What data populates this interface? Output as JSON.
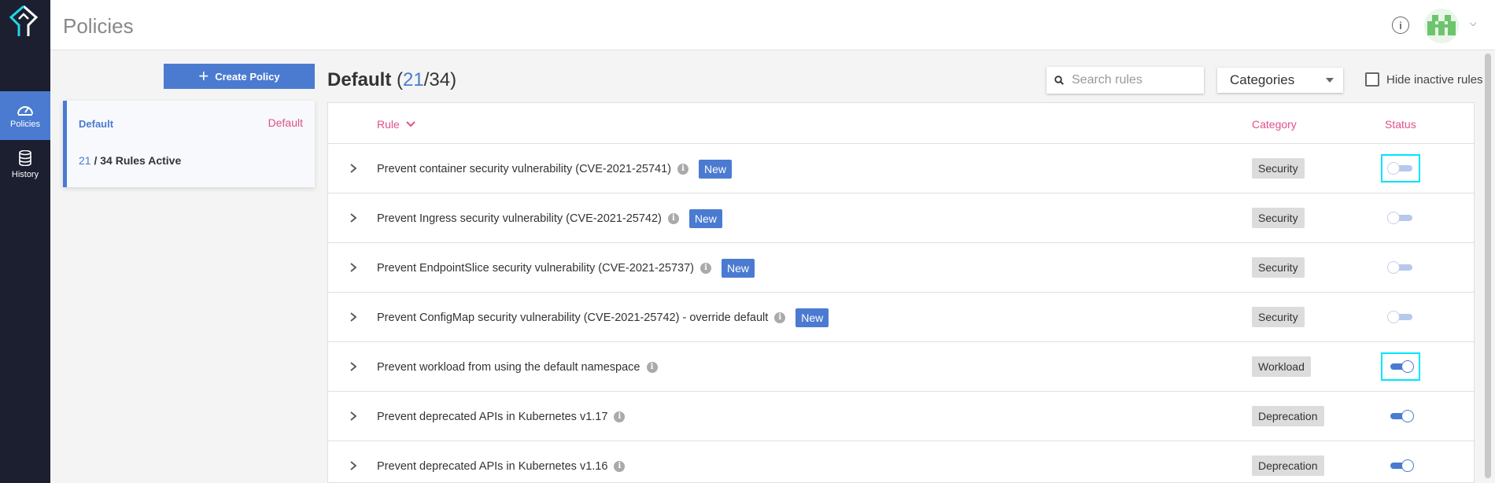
{
  "app": {
    "page_title": "Policies"
  },
  "sidebar": {
    "items": [
      {
        "label": "Policies",
        "icon": "gauge-icon",
        "active": true
      },
      {
        "label": "History",
        "icon": "database-icon",
        "active": false
      }
    ]
  },
  "header": {
    "info_icon": "info-icon",
    "avatar_icon": "avatar-icon"
  },
  "left_panel": {
    "create_label": "Create Policy",
    "policy": {
      "name": "Default",
      "tag": "Default",
      "active_count": "21",
      "count_suffix": " / 34 Rules Active"
    }
  },
  "main": {
    "heading": {
      "name": "Default",
      "active": "21",
      "total": "/34"
    },
    "search_placeholder": "Search rules",
    "categories_label": "Categories",
    "hide_inactive_label": "Hide inactive rules",
    "hide_inactive_checked": false,
    "columns": {
      "rule": "Rule",
      "category": "Category",
      "status": "Status"
    },
    "rows": [
      {
        "rule": "Prevent container security vulnerability (CVE-2021-25741)",
        "new": "New",
        "category": "Security",
        "enabled": false,
        "highlight": true
      },
      {
        "rule": "Prevent Ingress security vulnerability (CVE-2021-25742)",
        "new": "New",
        "category": "Security",
        "enabled": false,
        "highlight": false
      },
      {
        "rule": "Prevent EndpointSlice security vulnerability (CVE-2021-25737)",
        "new": "New",
        "category": "Security",
        "enabled": false,
        "highlight": false
      },
      {
        "rule": "Prevent ConfigMap security vulnerability (CVE-2021-25742) - override default",
        "new": "New",
        "category": "Security",
        "enabled": false,
        "highlight": false
      },
      {
        "rule": "Prevent workload from using the default namespace",
        "new": "",
        "category": "Workload",
        "enabled": true,
        "highlight": true
      },
      {
        "rule": "Prevent deprecated APIs in Kubernetes v1.17",
        "new": "",
        "category": "Deprecation",
        "enabled": true,
        "highlight": false
      },
      {
        "rule": "Prevent deprecated APIs in Kubernetes v1.16",
        "new": "",
        "category": "Deprecation",
        "enabled": true,
        "highlight": false
      }
    ]
  },
  "colors": {
    "accent": "#4a7bd1",
    "pink": "#e2508a",
    "sidebar": "#1b1f2f",
    "highlight": "#00e5ff"
  }
}
